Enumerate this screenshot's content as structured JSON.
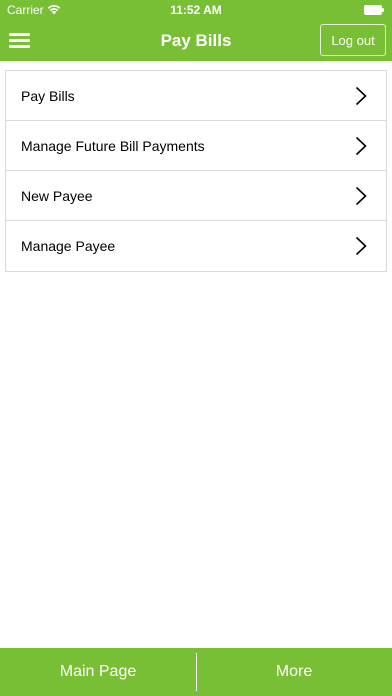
{
  "status_bar": {
    "carrier": "Carrier",
    "time": "11:52 AM",
    "icons": [
      "wifi-icon",
      "battery-icon"
    ]
  },
  "header": {
    "title": "Pay Bills",
    "logout_label": "Log out",
    "menu_icon": "hamburger-menu-icon"
  },
  "menu": {
    "items": [
      {
        "label": "Pay Bills"
      },
      {
        "label": "Manage Future Bill Payments"
      },
      {
        "label": "New Payee"
      },
      {
        "label": "Manage Payee"
      }
    ],
    "item_icon": "chevron-right-icon"
  },
  "tabbar": {
    "main_label": "Main Page",
    "more_label": "More"
  },
  "colors": {
    "brand_green": "#78bf35",
    "border": "#d9d9d9",
    "text": "#000000"
  }
}
